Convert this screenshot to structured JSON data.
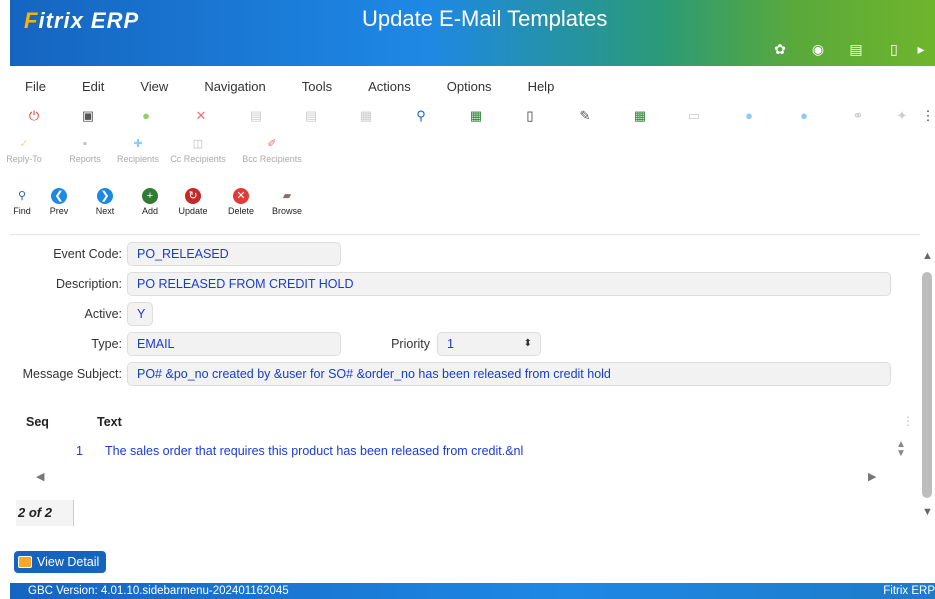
{
  "header": {
    "logo_f": "F",
    "logo_rest": "itrix ERP",
    "title": "Update E-Mail Templates",
    "icons": [
      "gear-icon",
      "globe-icon",
      "document-icon",
      "blank-page-icon",
      "play-icon"
    ]
  },
  "menu": [
    "File",
    "Edit",
    "View",
    "Navigation",
    "Tools",
    "Actions",
    "Options",
    "Help"
  ],
  "toolbar2": [
    {
      "label": "Reply-To",
      "icon": "reply-icon"
    },
    {
      "label": "Reports",
      "icon": "reports-icon"
    },
    {
      "label": "Recipients",
      "icon": "recipients-icon"
    },
    {
      "label": "Cc Recipients",
      "icon": "cc-icon"
    },
    {
      "label": "Bcc Recipients",
      "icon": "bcc-icon"
    }
  ],
  "toolbar3": [
    {
      "label": "Find",
      "icon": "magnifier-icon",
      "color": "#1e88e5"
    },
    {
      "label": "Prev",
      "icon": "prev-icon",
      "color": "#1e88e5"
    },
    {
      "label": "Next",
      "icon": "next-icon",
      "color": "#1e88e5"
    },
    {
      "label": "Add",
      "icon": "add-icon",
      "color": "#2e7d32"
    },
    {
      "label": "Update",
      "icon": "update-icon",
      "color": "#c62828"
    },
    {
      "label": "Delete",
      "icon": "delete-icon",
      "color": "#e53935"
    },
    {
      "label": "Browse",
      "icon": "browse-icon",
      "color": "#8d6e63"
    }
  ],
  "form": {
    "event_code_label": "Event Code:",
    "event_code": "PO_RELEASED",
    "description_label": "Description:",
    "description": "PO RELEASED FROM CREDIT HOLD",
    "active_label": "Active:",
    "active": "Y",
    "type_label": "Type:",
    "type": "EMAIL",
    "priority_label": "Priority",
    "priority": "1",
    "subject_label": "Message Subject:",
    "subject": "PO# &po_no created by &user for SO# &order_no has been released from credit hold"
  },
  "grid": {
    "columns": [
      "Seq",
      "Text"
    ],
    "rows": [
      {
        "seq": "1",
        "text": "The sales order that requires this product has been released from credit.&nl"
      }
    ]
  },
  "status": "2 of 2",
  "view_detail_label": "View Detail",
  "footer": {
    "version": "GBC Version: 4.01.10.sidebarmenu-202401162045",
    "brand": "Fitrix ERP"
  }
}
